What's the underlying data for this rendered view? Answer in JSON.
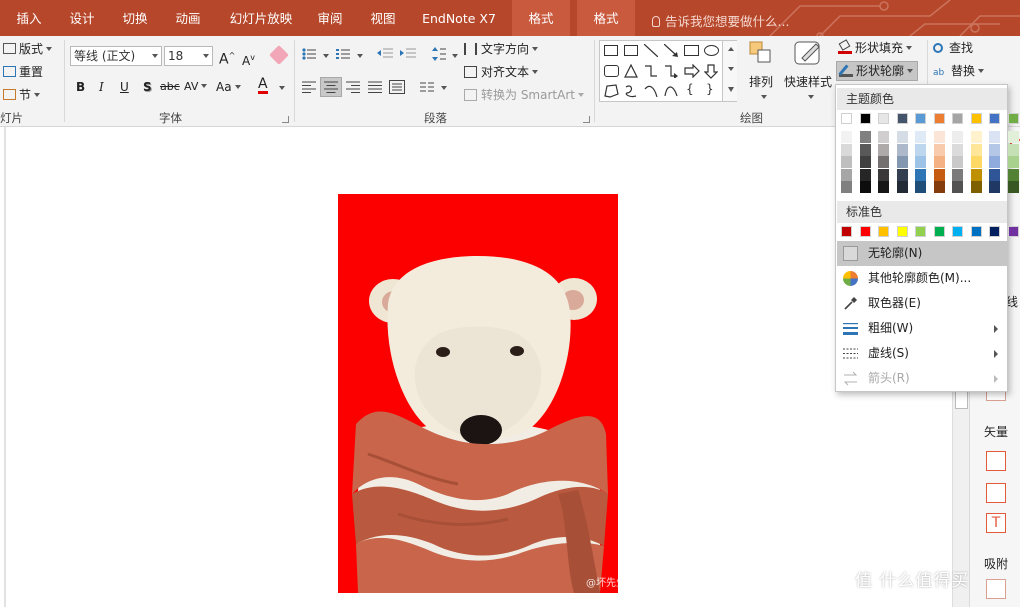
{
  "tabs": [
    "插入",
    "设计",
    "切换",
    "动画",
    "幻灯片放映",
    "审阅",
    "视图",
    "EndNote X7",
    "格式",
    "格式"
  ],
  "tell_me": "告诉我您想要做什么...",
  "ribbon": {
    "slides": {
      "layout": "版式",
      "reset": "重置",
      "section": "节",
      "label": "灯片"
    },
    "font": {
      "name": "等线 (正文)",
      "size": "18",
      "grow": "A",
      "shrink": "A",
      "bold": "B",
      "italic": "I",
      "underline": "U",
      "shadow": "S",
      "strike": "abc",
      "spacing": "AV",
      "case": "Aa",
      "color_a": "A",
      "label": "字体"
    },
    "paragraph": {
      "text_direction": "文字方向",
      "align_text": "对齐文本",
      "smartart": "转换为 SmartArt",
      "label": "段落"
    },
    "drawing": {
      "arrange": "排列",
      "quick_styles": "快速样式",
      "fill": "形状填充",
      "outline": "形状轮廓",
      "label": "绘图"
    },
    "editing": {
      "find": "查找",
      "replace": "替换"
    }
  },
  "dropdown": {
    "theme_colors_label": "主题颜色",
    "standard_colors_label": "标准色",
    "theme_top": [
      "#ffffff",
      "#000000",
      "#e7e6e6",
      "#44546a",
      "#5b9bd5",
      "#ed7d31",
      "#a5a5a5",
      "#ffc000",
      "#4472c4",
      "#70ad47"
    ],
    "theme_shades": [
      [
        "#f2f2f2",
        "#d9d9d9",
        "#bfbfbf",
        "#a6a6a6",
        "#808080"
      ],
      [
        "#808080",
        "#595959",
        "#404040",
        "#262626",
        "#0d0d0d"
      ],
      [
        "#d0cece",
        "#aeaaaa",
        "#757070",
        "#3a3838",
        "#171616"
      ],
      [
        "#d6dce5",
        "#adb9ca",
        "#8497b0",
        "#333f50",
        "#222a35"
      ],
      [
        "#deebf7",
        "#bdd7ee",
        "#9dc3e6",
        "#2e75b6",
        "#1f4e79"
      ],
      [
        "#fbe5d6",
        "#f8cbad",
        "#f4b183",
        "#c55a11",
        "#843c0c"
      ],
      [
        "#ededed",
        "#dbdbdb",
        "#c9c9c9",
        "#7b7b7b",
        "#525252"
      ],
      [
        "#fff2cc",
        "#ffe699",
        "#ffd966",
        "#bf9000",
        "#7f6000"
      ],
      [
        "#dae3f3",
        "#b4c7e7",
        "#8faadc",
        "#2f5597",
        "#203864"
      ],
      [
        "#e2f0d9",
        "#c5e0b4",
        "#a9d18e",
        "#548235",
        "#385723"
      ]
    ],
    "standard": [
      "#c00000",
      "#ff0000",
      "#ffc000",
      "#ffff00",
      "#92d050",
      "#00b050",
      "#00b0f0",
      "#0070c0",
      "#002060",
      "#7030a0"
    ],
    "items": [
      {
        "label": "无轮廓(N)",
        "state": "hover"
      },
      {
        "label": "其他轮廓颜色(M)..."
      },
      {
        "label": "取色器(E)"
      },
      {
        "label": "粗细(W)"
      },
      {
        "label": "虚线(S)"
      },
      {
        "label": "箭头(R)",
        "state": "disabled"
      }
    ]
  },
  "pane": {
    "line": "线",
    "vector": "矢量",
    "snap": "吸附"
  },
  "watermark": "值 什么值得买",
  "photo_watermark": "@坏先生",
  "colors": {
    "accent": "#b7472a",
    "active_tab": "#c95a3e",
    "photo_bg": "#fc0000",
    "scarf": "#c8654a"
  }
}
